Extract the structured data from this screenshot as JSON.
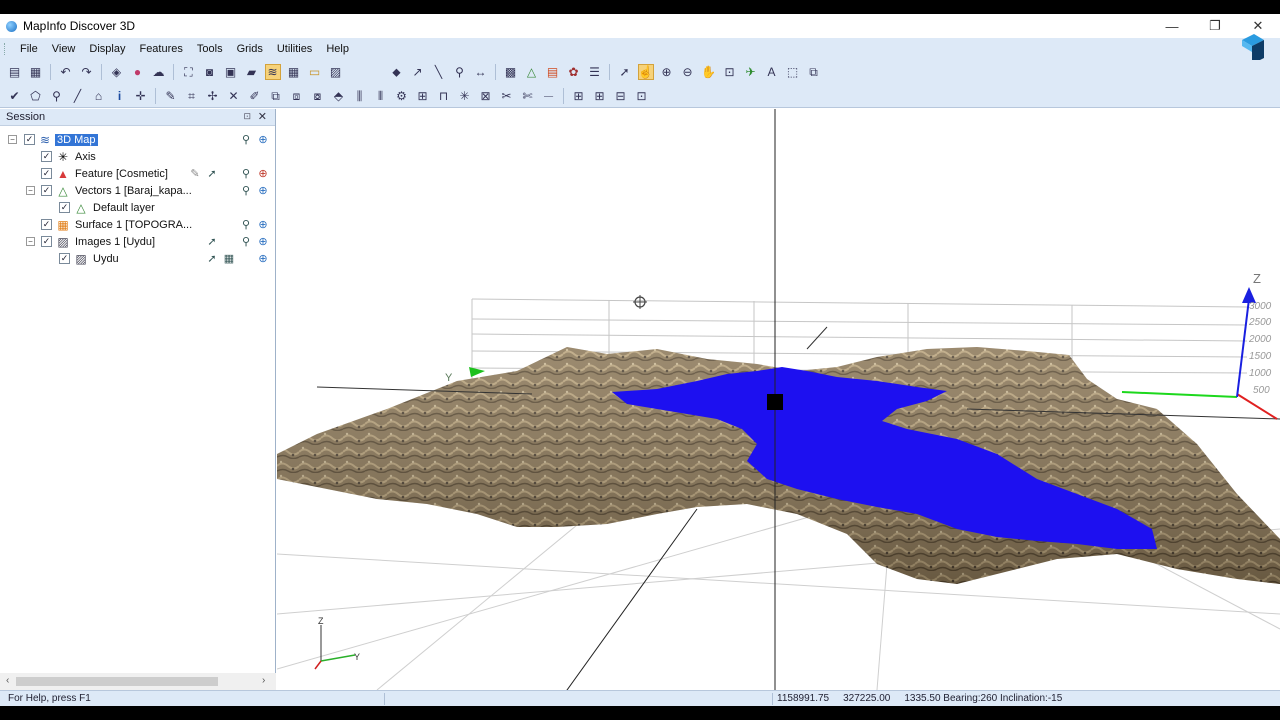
{
  "window": {
    "title": "MapInfo Discover 3D",
    "minimize": "—",
    "restore": "❐",
    "close": "✕"
  },
  "menu": [
    "File",
    "View",
    "Display",
    "Features",
    "Tools",
    "Grids",
    "Utilities",
    "Help"
  ],
  "session": {
    "title": "Session",
    "pin": "⊡",
    "close": "✕",
    "items": [
      {
        "label": "3D Map",
        "icon": "layers-stack-icon"
      },
      {
        "label": "Axis",
        "icon": "axis-icon"
      },
      {
        "label": "Feature [Cosmetic]",
        "icon": "cosmetic-layer-icon"
      },
      {
        "label": "Vectors 1 [Baraj_kapa...",
        "icon": "vector-layer-icon"
      },
      {
        "label": "Default layer",
        "icon": "polygon-layer-icon"
      },
      {
        "label": "Surface 1 [TOPOGRA...",
        "icon": "surface-layer-icon"
      },
      {
        "label": "Images 1 [Uydu]",
        "icon": "image-layer-icon"
      },
      {
        "label": "Uydu",
        "icon": "image-icon"
      }
    ]
  },
  "viewport": {
    "axis_labels": {
      "y_left": "Y",
      "z_top": "Z",
      "gizmo_z": "Z",
      "gizmo_y": "Y"
    },
    "z_ticks": [
      "3000",
      "2500",
      "2000",
      "1500",
      "1000",
      "500"
    ],
    "colors": {
      "water": "#1d10f0",
      "terrain": "#8c7a5c",
      "grid": "#c9c9c9"
    }
  },
  "status": {
    "help": "For Help, press F1",
    "x": "1158991.75",
    "y": "327225.00",
    "elevation_bearing_inclination": "1335.50  Bearing:260  Inclination:-15"
  }
}
